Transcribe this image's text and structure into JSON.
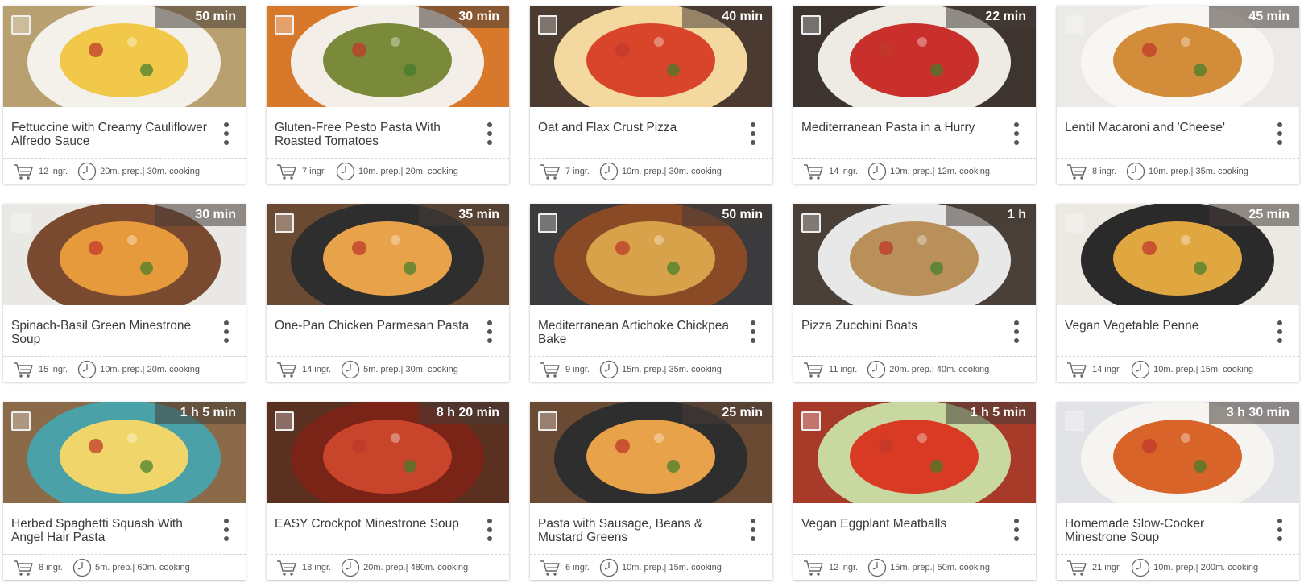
{
  "recipes": [
    {
      "title": "Fettuccine with Creamy Cauliflower Alfredo Sauce",
      "time": "50 min",
      "ingredients": "12 ingr.",
      "prep": "20m. prep.| 30m. cooking",
      "bg": "#b8a070",
      "plate": "#f4f1ea",
      "food": "#f1c84a"
    },
    {
      "title": "Gluten-Free Pesto Pasta With Roasted Tomatoes",
      "time": "30 min",
      "ingredients": "7 ingr.",
      "prep": "10m. prep.| 20m. cooking",
      "bg": "#d8782a",
      "plate": "#f3efe8",
      "food": "#7a8a3a"
    },
    {
      "title": "Oat and Flax Crust Pizza",
      "time": "40 min",
      "ingredients": "7 ingr.",
      "prep": "10m. prep.| 30m. cooking",
      "bg": "#4a3a30",
      "plate": "#f3d9a0",
      "food": "#d9452b"
    },
    {
      "title": "Mediterranean Pasta in a Hurry",
      "time": "22 min",
      "ingredients": "14 ingr.",
      "prep": "10m. prep.| 12m. cooking",
      "bg": "#3d3430",
      "plate": "#eeeae4",
      "food": "#c9302c"
    },
    {
      "title": "Lentil Macaroni and 'Cheese'",
      "time": "45 min",
      "ingredients": "8 ingr.",
      "prep": "10m. prep.| 35m. cooking",
      "bg": "#eceae6",
      "plate": "#f8f6f2",
      "food": "#d38d3a"
    },
    {
      "title": "Spinach-Basil Green Minestrone Soup",
      "time": "30 min",
      "ingredients": "15 ingr.",
      "prep": "10m. prep.| 20m. cooking",
      "bg": "#e9e8e4",
      "plate": "#7a4a30",
      "food": "#e79a3c"
    },
    {
      "title": "One-Pan Chicken Parmesan Pasta",
      "time": "35 min",
      "ingredients": "14 ingr.",
      "prep": "5m. prep.| 30m. cooking",
      "bg": "#6a4a32",
      "plate": "#2e2e2e",
      "food": "#e8a24a"
    },
    {
      "title": "Mediterranean Artichoke Chickpea Bake",
      "time": "50 min",
      "ingredients": "9 ingr.",
      "prep": "15m. prep.| 35m. cooking",
      "bg": "#3b3a3c",
      "plate": "#8a4a26",
      "food": "#d7a24a"
    },
    {
      "title": "Pizza Zucchini Boats",
      "time": "1 h",
      "ingredients": "11 ingr.",
      "prep": "20m. prep.| 40m. cooking",
      "bg": "#4a4038",
      "plate": "#e8e8e8",
      "food": "#b9905a"
    },
    {
      "title": "Vegan Vegetable Penne",
      "time": "25 min",
      "ingredients": "14 ingr.",
      "prep": "10m. prep.| 15m. cooking",
      "bg": "#ece8e2",
      "plate": "#2a2a2a",
      "food": "#e0a640"
    },
    {
      "title": "Herbed Spaghetti Squash With Angel Hair Pasta",
      "time": "1 h 5 min",
      "ingredients": "8 ingr.",
      "prep": "5m. prep.| 60m. cooking",
      "bg": "#8a6a48",
      "plate": "#4aa2a8",
      "food": "#f0d66a"
    },
    {
      "title": "EASY Crockpot Minestrone Soup",
      "time": "8 h 20 min",
      "ingredients": "18 ingr.",
      "prep": "20m. prep.| 480m. cooking",
      "bg": "#5a3020",
      "plate": "#7a2418",
      "food": "#c8452c"
    },
    {
      "title": "Pasta with Sausage, Beans & Mustard Greens",
      "time": "25 min",
      "ingredients": "6 ingr.",
      "prep": "10m. prep.| 15m. cooking",
      "bg": "#6a4a32",
      "plate": "#2e2e2e",
      "food": "#e8a24a"
    },
    {
      "title": "Vegan Eggplant Meatballs",
      "time": "1 h 5 min",
      "ingredients": "12 ingr.",
      "prep": "15m. prep.| 50m. cooking",
      "bg": "#a83a2a",
      "plate": "#c8d8a0",
      "food": "#d83a24"
    },
    {
      "title": "Homemade Slow-Cooker Minestrone Soup",
      "time": "3 h 30 min",
      "ingredients": "21 ingr.",
      "prep": "10m. prep.| 200m. cooking",
      "bg": "#e2e3e6",
      "plate": "#f6f4f0",
      "food": "#d8642a"
    }
  ]
}
